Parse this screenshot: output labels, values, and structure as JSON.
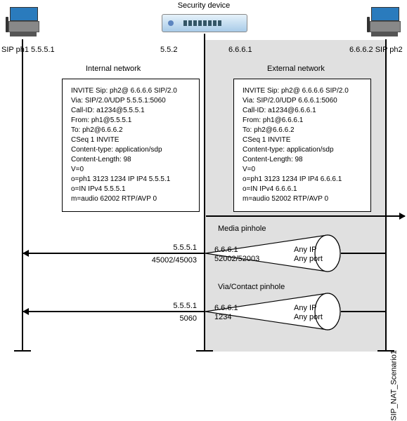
{
  "title": "Security device",
  "left_phone_label": "SIP ph1 5.5.5.1",
  "right_phone_label": "6.6.6.2 SIP ph2",
  "switch_ip_left": "5.5.2",
  "switch_ip_right": "6.6.6.1",
  "internal_label": "Internal network",
  "external_label": "External network",
  "internal_msg": {
    "l1": "INVITE Sip: ph2@ 6.6.6.6 SIP/2.0",
    "l2": "Via: SIP/2.0/UDP 5.5.5.1:5060",
    "l3": "Call-ID: a1234@5.5.5.1",
    "l4": "From: ph1@5.5.5.1",
    "l5": "To: ph2@6.6.6.2",
    "l6": "CSeq 1 INVITE",
    "l7": "Content-type: application/sdp",
    "l8": "Content-Length: 98",
    "l9": "V=0",
    "l10": "o=ph1 3123 1234 IP IP4 5.5.5.1",
    "l11": "o=IN IPv4 5.5.5.1",
    "l12": "m=audio 62002 RTP/AVP 0"
  },
  "external_msg": {
    "l1": "INVITE Sip: ph2@ 6.6.6.6 SIP/2.0",
    "l2": "Via: SIP/2.0/UDP 6.6.6.1:5060",
    "l3": "Call-ID: a1234@6.6.6.1",
    "l4": "From: ph1@6.6.6.1",
    "l5": "To: ph2@6.6.6.2",
    "l6": "CSeq 1 INVITE",
    "l7": "Content-type: application/sdp",
    "l8": "Content-Length: 98",
    "l9": "V=0",
    "l10": "o=ph1 3123 1234 IP IP4 6.6.6.1",
    "l11": "o=IN IPv4 6.6.6.1",
    "l12": "m=audio 52002 RTP/AVP 0"
  },
  "media_pinhole_label": "Media pinhole",
  "via_pinhole_label": "Via/Contact pinhole",
  "media_left_ip": "5.5.5.1",
  "media_left_ports": "45002/45003",
  "media_right_ip": "6.6.6.1",
  "media_right_ports": "52002/52003",
  "via_left_ip": "5.5.5.1",
  "via_left_port": "5060",
  "via_right_ip": "6.6.6.1",
  "via_right_port": "1234",
  "any_ip": "Any IP",
  "any_port": "Any port",
  "fig_ref": "SIP_NAT_Scenario1",
  "chart_data": {
    "type": "table",
    "title": "SIP NAT Scenario 1 — translations and pinholes",
    "nodes": [
      {
        "name": "SIP ph1",
        "ip": "5.5.5.1",
        "side": "internal"
      },
      {
        "name": "Security device internal",
        "ip": "5.5.2",
        "side": "internal"
      },
      {
        "name": "Security device external",
        "ip": "6.6.6.1",
        "side": "external"
      },
      {
        "name": "SIP ph2",
        "ip": "6.6.6.2",
        "side": "external"
      }
    ],
    "pinholes": [
      {
        "name": "Media pinhole",
        "nat_inside": {
          "ip": "5.5.5.1",
          "ports": "45002/45003"
        },
        "nat_outside": {
          "ip": "6.6.6.1",
          "ports": "52002/52003"
        },
        "remote": {
          "ip": "Any IP",
          "port": "Any port"
        }
      },
      {
        "name": "Via/Contact pinhole",
        "nat_inside": {
          "ip": "5.5.5.1",
          "ports": "5060"
        },
        "nat_outside": {
          "ip": "6.6.6.1",
          "ports": "1234"
        },
        "remote": {
          "ip": "Any IP",
          "port": "Any port"
        }
      }
    ],
    "sip_translation": [
      {
        "field": "Via",
        "before": "5.5.5.1:5060",
        "after": "6.6.6.1:5060"
      },
      {
        "field": "Call-ID",
        "before": "a1234@5.5.5.1",
        "after": "a1234@6.6.6.1"
      },
      {
        "field": "From",
        "before": "ph1@5.5.5.1",
        "after": "ph1@6.6.6.1"
      },
      {
        "field": "SDP o= IP",
        "before": "5.5.5.1",
        "after": "6.6.6.1"
      },
      {
        "field": "SDP m=audio port",
        "before": "62002",
        "after": "52002"
      }
    ]
  }
}
